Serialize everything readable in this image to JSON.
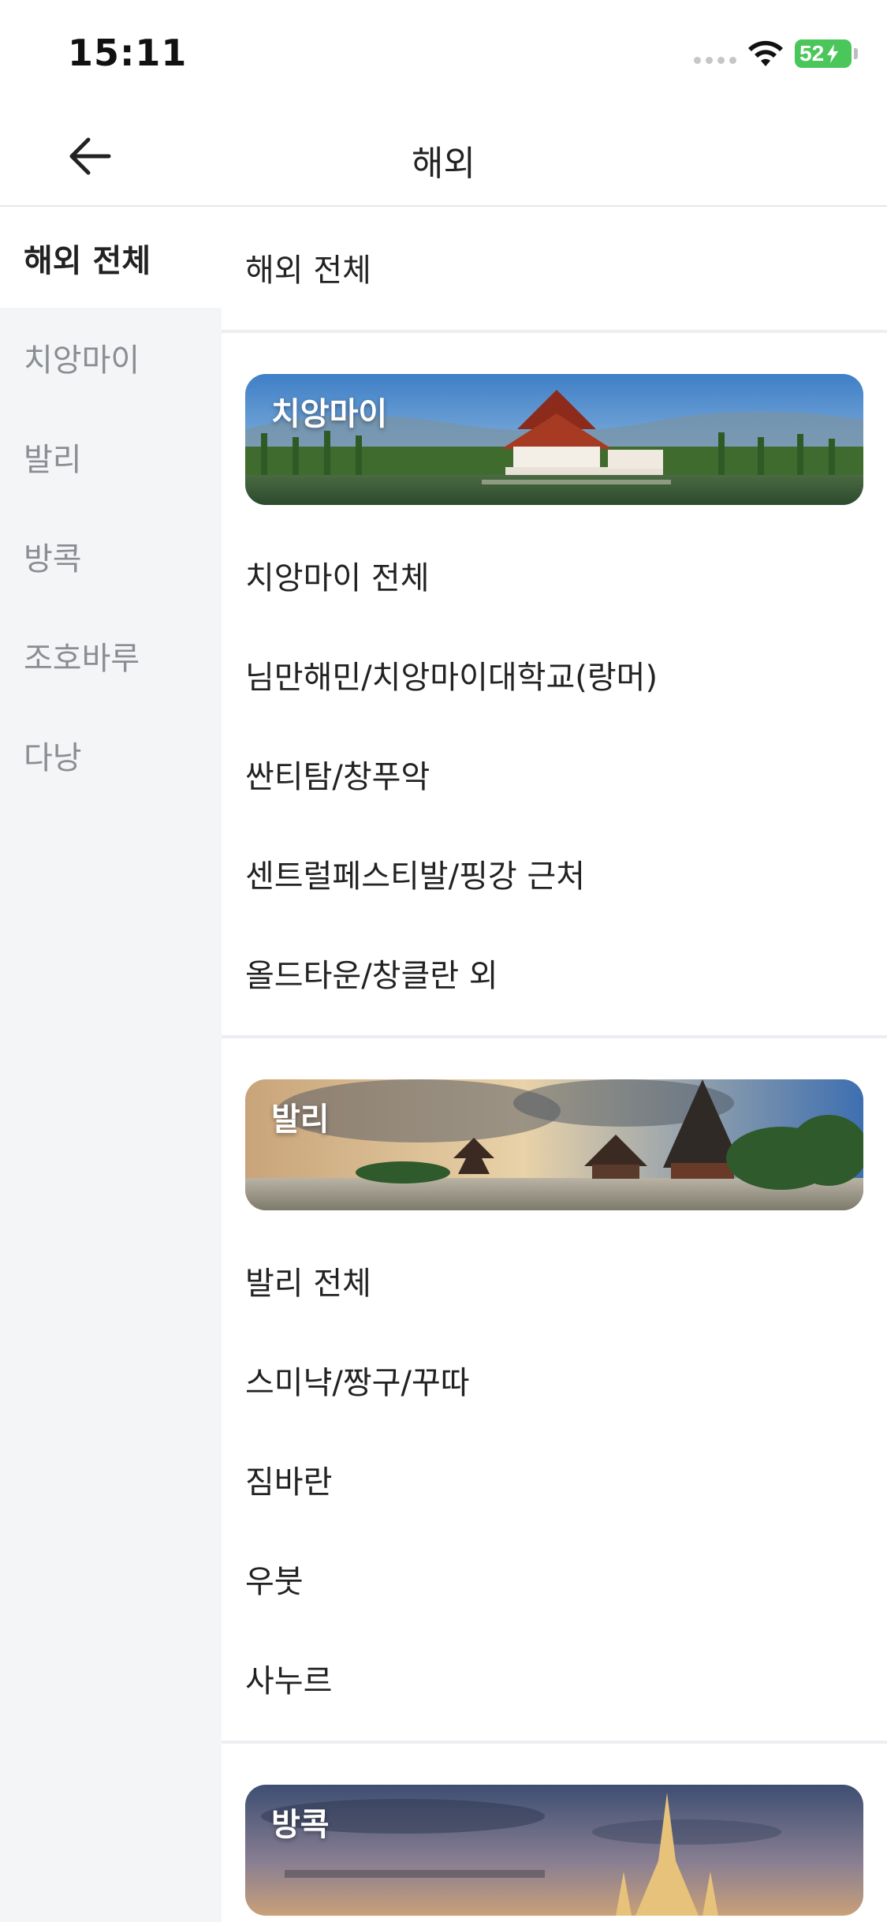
{
  "status": {
    "time": "15:11",
    "battery": "52"
  },
  "nav": {
    "title": "해외"
  },
  "sidebar": {
    "items": [
      {
        "label": "해외 전체",
        "active": true
      },
      {
        "label": "치앙마이"
      },
      {
        "label": "발리"
      },
      {
        "label": "방콕"
      },
      {
        "label": "조호바루"
      },
      {
        "label": "다낭"
      }
    ]
  },
  "main": {
    "all_label": "해외 전체",
    "regions": [
      {
        "banner": "치앙마이",
        "rows": [
          "치앙마이 전체",
          "님만해민/치앙마이대학교(랑머)",
          "싼티탐/창푸악",
          "센트럴페스티발/핑강 근처",
          "올드타운/창클란 외"
        ]
      },
      {
        "banner": "발리",
        "rows": [
          "발리 전체",
          "스미냑/짱구/꾸따",
          "짐바란",
          "우붓",
          "사누르"
        ]
      },
      {
        "banner": "방콕",
        "rows": []
      }
    ]
  },
  "colors": {
    "sidebar_bg": "#f4f5f7",
    "battery": "#4bc65a",
    "divider": "#eceef1"
  }
}
